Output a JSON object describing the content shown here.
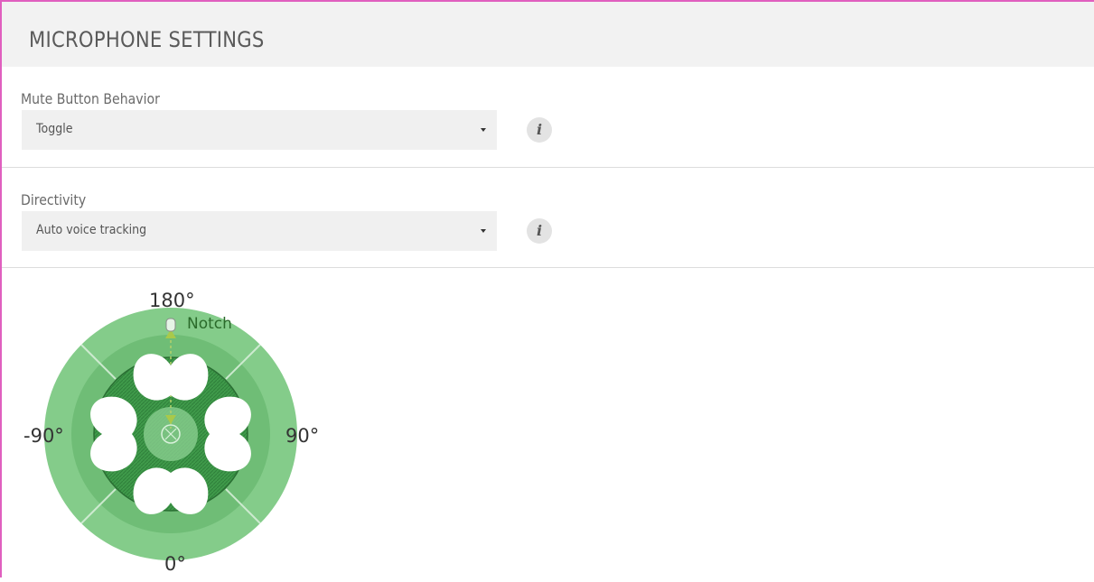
{
  "header": {
    "title": "MICROPHONE SETTINGS"
  },
  "mute_behavior": {
    "label": "Mute Button Behavior",
    "selected": "Toggle",
    "info_icon": "info-icon"
  },
  "directivity": {
    "label": "Directivity",
    "selected": "Auto voice tracking",
    "info_icon": "info-icon"
  },
  "polar_display": {
    "angle_top": "180°",
    "angle_left": "-90°",
    "angle_right": "90°",
    "angle_bottom": "0°",
    "notch_label": "Notch",
    "colors": {
      "outer_ring": "#84cc8a",
      "inner_ring": "#6fbd76",
      "core": "#3f9a4a",
      "center": "#8fd194",
      "lobes": "#ffffff"
    }
  },
  "frame": {
    "accent_color": "#e05fbf"
  }
}
